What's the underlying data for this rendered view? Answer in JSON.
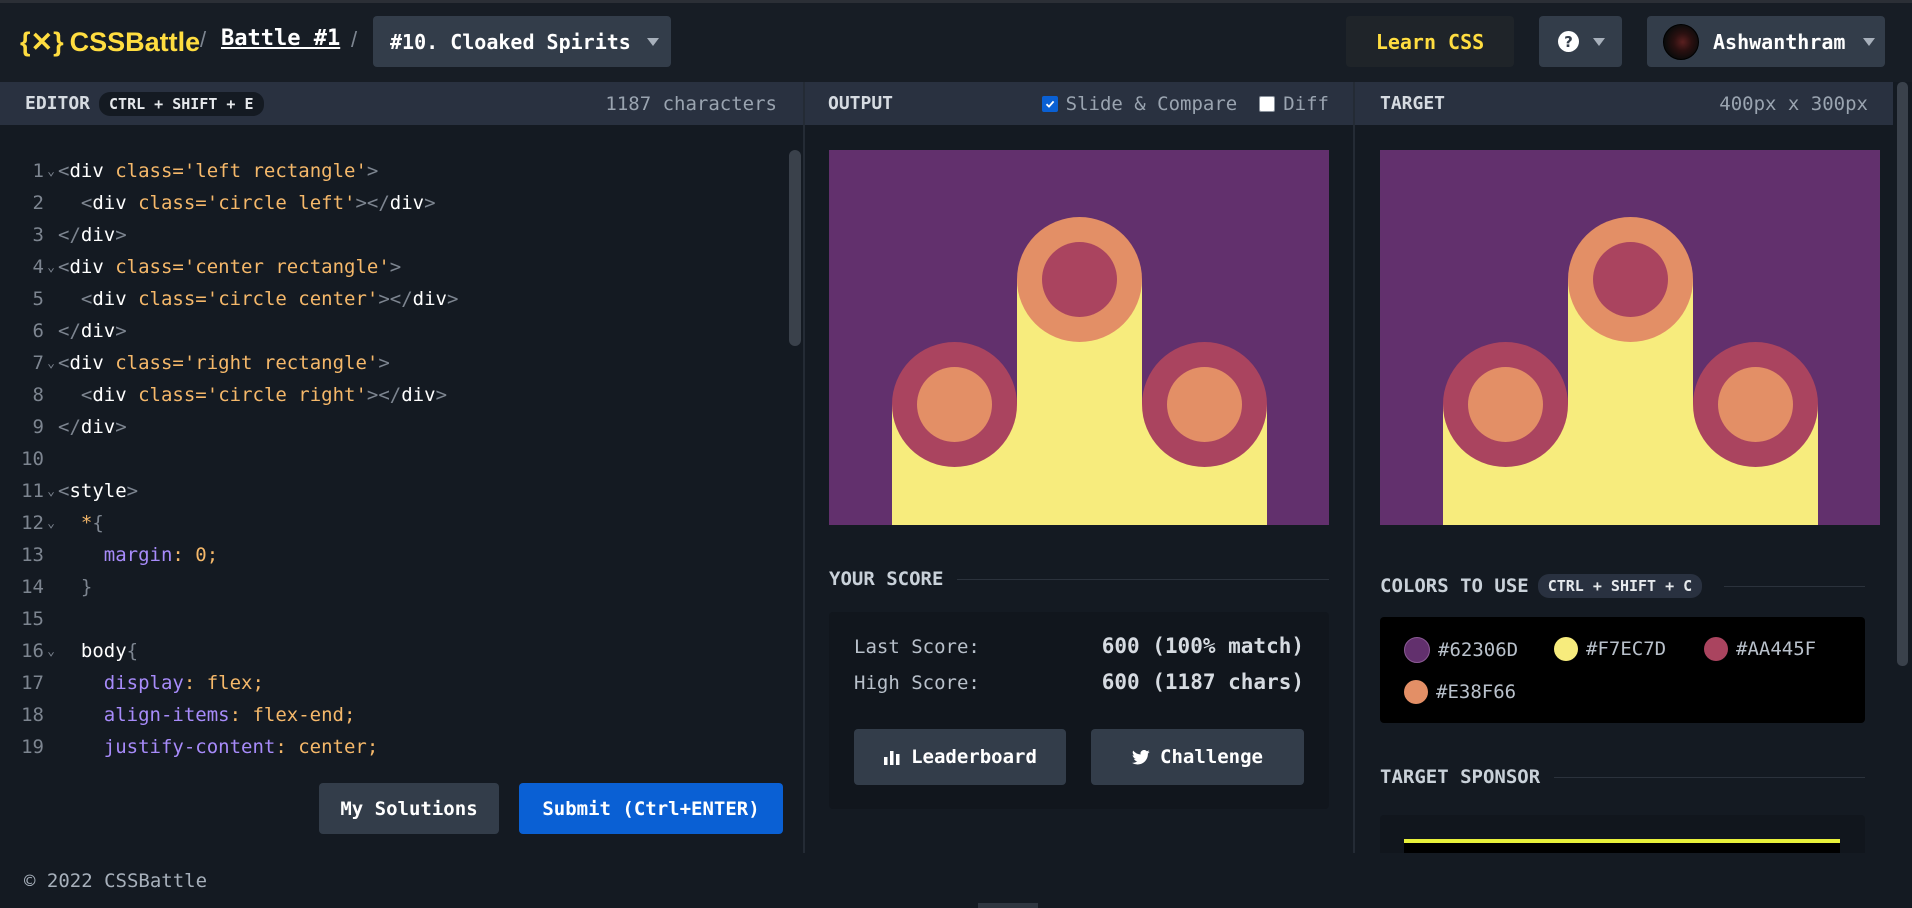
{
  "header": {
    "logo_text": "CSSBattle",
    "logo_mark": "{✕}",
    "separator": "/",
    "battle_link": "Battle #1",
    "level_title": "#10. Cloaked Spirits",
    "learn_css": "Learn CSS",
    "help_icon": "?",
    "username": "Ashwanthram"
  },
  "editor": {
    "title": "EDITOR",
    "shortcut": "CTRL + SHIFT + E",
    "char_count": "1187 characters",
    "lines": [
      {
        "n": "1",
        "text": "<div class='left rectangle'>"
      },
      {
        "n": "2",
        "text": "  <div class='circle left'></div>"
      },
      {
        "n": "3",
        "text": "</div>"
      },
      {
        "n": "4",
        "text": "<div class='center rectangle'>"
      },
      {
        "n": "5",
        "text": "  <div class='circle center'></div>"
      },
      {
        "n": "6",
        "text": "</div>"
      },
      {
        "n": "7",
        "text": "<div class='right rectangle'>"
      },
      {
        "n": "8",
        "text": "  <div class='circle right'></div>"
      },
      {
        "n": "9",
        "text": "</div>"
      },
      {
        "n": "10",
        "text": ""
      },
      {
        "n": "11",
        "text": "<style>"
      },
      {
        "n": "12",
        "text": "  *{"
      },
      {
        "n": "13",
        "text": "    margin: 0;"
      },
      {
        "n": "14",
        "text": "  }"
      },
      {
        "n": "15",
        "text": ""
      },
      {
        "n": "16",
        "text": "  body{"
      },
      {
        "n": "17",
        "text": "    display: flex;"
      },
      {
        "n": "18",
        "text": "    align-items: flex-end;"
      },
      {
        "n": "19",
        "text": "    justify-content: center;"
      }
    ],
    "my_solutions": "My Solutions",
    "submit": "Submit (Ctrl+ENTER)"
  },
  "output": {
    "title": "OUTPUT",
    "slide_compare": "Slide & Compare",
    "slide_compare_checked": true,
    "diff": "Diff",
    "diff_checked": false
  },
  "target": {
    "title": "TARGET",
    "size": "400px x 300px"
  },
  "score": {
    "title": "YOUR SCORE",
    "last_label": "Last Score:",
    "last_value": "600 (100% match)",
    "high_label": "High Score:",
    "high_value": "600 (1187 chars)",
    "leaderboard": "Leaderboard",
    "challenge": "Challenge"
  },
  "colors": {
    "title": "COLORS TO USE",
    "shortcut": "CTRL + SHIFT + C",
    "items": [
      {
        "hex": "#62306D",
        "color": "#62306D"
      },
      {
        "hex": "#F7EC7D",
        "color": "#F7EC7D"
      },
      {
        "hex": "#AA445F",
        "color": "#AA445F"
      },
      {
        "hex": "#E38F66",
        "color": "#E38F66"
      }
    ]
  },
  "sponsor": {
    "title": "TARGET SPONSOR"
  },
  "footer": {
    "copyright": "© 2022 CSSBattle"
  }
}
